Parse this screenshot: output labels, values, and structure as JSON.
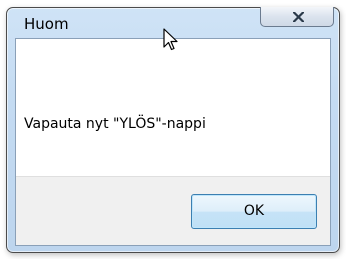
{
  "dialog": {
    "title": "Huom",
    "message": "Vapauta nyt \"YLÖS\"-nappi",
    "ok_label": "OK",
    "close_icon": "close-icon"
  },
  "colors": {
    "frame": "#c4dbf2",
    "footer": "#f0f0f0",
    "button_border": "#3c7fb1"
  }
}
